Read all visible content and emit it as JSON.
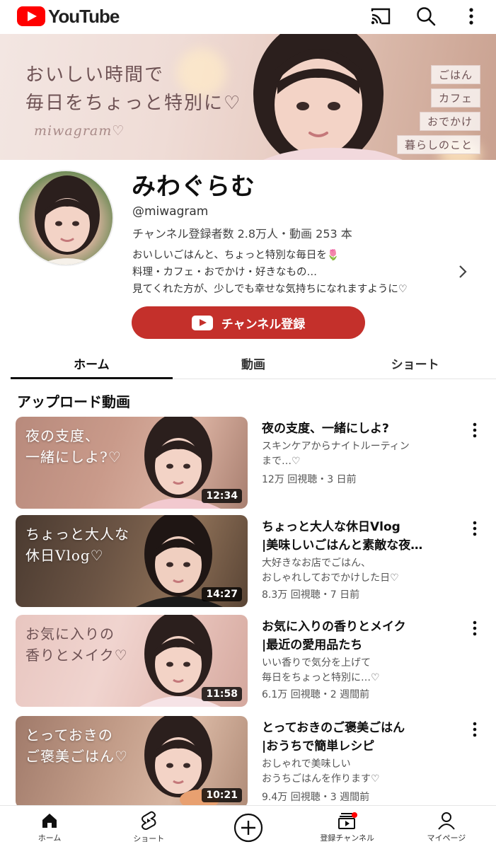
{
  "app": {
    "logo_text": "YouTube"
  },
  "appbar": {
    "icons": [
      "cast-icon",
      "search-icon",
      "more-vert-icon"
    ]
  },
  "banner": {
    "line1": "おいしい時間で",
    "line2": "毎日をちょっと特別に♡",
    "signature": "miwagram♡",
    "tags": [
      "ごはん",
      "カフェ",
      "おでかけ",
      "暮らしのこと"
    ]
  },
  "channel": {
    "name": "みわぐらむ",
    "handle": "@miwagram",
    "stats": "チャンネル登録者数 2.8万人・動画 253 本",
    "description": [
      "おいしいごはんと、ちょっと特別な毎日を🌷",
      "料理・カフェ・おでかけ・好きなもの…",
      "見てくれた方が、少しでも幸せな気持ちになれますように♡"
    ],
    "subscribe_label": "チャンネル登録"
  },
  "tabs": [
    {
      "label": "ホーム",
      "active": true
    },
    {
      "label": "動画",
      "active": false
    },
    {
      "label": "ショート",
      "active": false
    }
  ],
  "section": {
    "title": "アップロード動画"
  },
  "videos": [
    {
      "thumb_caption": "夜の支度、\n一緒にしよ?♡",
      "duration": "12:34",
      "title_lines": [
        "夜の支度、一緒にしよ?"
      ],
      "desc_lines": [
        "スキンケアからナイトルーティン",
        "まで…♡"
      ],
      "meta": "12万 回視聴・3 日前"
    },
    {
      "thumb_caption": "ちょっと大人な\n休日Vlog♡",
      "duration": "14:27",
      "title_lines": [
        "ちょっと大人な休日Vlog",
        "|美味しいごはんと素敵な夜…"
      ],
      "desc_lines": [
        "大好きなお店でごはん、",
        "おしゃれしておでかけした日♡"
      ],
      "meta": "8.3万 回視聴・7 日前"
    },
    {
      "thumb_caption": "お気に入りの\n香りとメイク♡",
      "duration": "11:58",
      "title_lines": [
        "お気に入りの香りとメイク",
        "|最近の愛用品たち"
      ],
      "desc_lines": [
        "いい香りで気分を上げて",
        "毎日をちょっと特別に…♡"
      ],
      "meta": "6.1万 回視聴・2 週間前"
    },
    {
      "thumb_caption": "とっておきの\nご褒美ごはん♡",
      "duration": "10:21",
      "title_lines": [
        "とっておきのご褒美ごはん",
        "|おうちで簡単レシピ"
      ],
      "desc_lines": [
        "おしゃれで美味しい",
        "おうちごはんを作ります♡"
      ],
      "meta": "9.4万 回視聴・3 週間前"
    }
  ],
  "bottom_nav": [
    {
      "label": "ホーム",
      "icon": "home-icon"
    },
    {
      "label": "ショート",
      "icon": "shorts-icon"
    },
    {
      "label": "",
      "icon": "create-plus-icon"
    },
    {
      "label": "登録チャンネル",
      "icon": "subscriptions-icon"
    },
    {
      "label": "マイページ",
      "icon": "account-icon"
    }
  ],
  "colors": {
    "accent": "#c4302b",
    "brand_red": "#ff0000",
    "text": "#0f0f0f",
    "secondary": "#555555"
  }
}
